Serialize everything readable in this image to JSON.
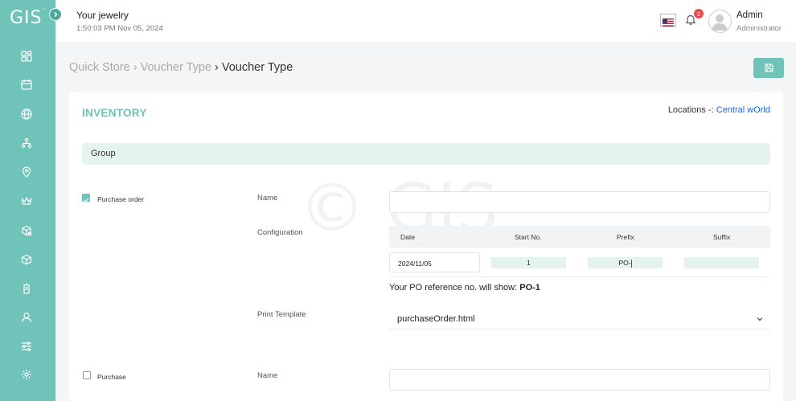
{
  "app": {
    "logo": "GIS",
    "logo_tm": "™"
  },
  "header": {
    "company": "Your jewelry",
    "datetime": "1:50:03 PM Nov 05, 2024",
    "notification_count": "2",
    "user_name": "Admin",
    "user_role": "Administrator"
  },
  "sidebar": {
    "items": [
      {
        "icon": "dashboard-icon"
      },
      {
        "icon": "calendar-icon"
      },
      {
        "icon": "globe-icon"
      },
      {
        "icon": "hierarchy-icon"
      },
      {
        "icon": "location-pin-icon"
      },
      {
        "icon": "crown-icon"
      },
      {
        "icon": "package-search-icon"
      },
      {
        "icon": "box-icon"
      },
      {
        "icon": "mobile-icon"
      },
      {
        "icon": "user-icon"
      },
      {
        "icon": "sliders-icon"
      },
      {
        "icon": "settings-icon"
      }
    ]
  },
  "breadcrumb": {
    "items": [
      "Quick Store",
      "Voucher Type"
    ],
    "current": "Voucher Type"
  },
  "page": {
    "section_title": "INVENTORY",
    "locations_label": "Locations -:",
    "locations_value": "Central wOrld",
    "group_title": "Group",
    "watermark": "© GIS"
  },
  "purchase_order": {
    "checkbox_label": "Purchase order",
    "checked": true,
    "name_label": "Name",
    "name_value": "",
    "configuration_label": "Configuration",
    "config_headers": [
      "Date",
      "Start No.",
      "Prefix",
      "Suffix"
    ],
    "config_values": {
      "date": "2024/11/05",
      "start_no": "1",
      "prefix": "PO-",
      "suffix": ""
    },
    "ref_note_label": "Your PO reference no. will show:",
    "ref_note_value": "PO-1",
    "print_template_label": "Print Template",
    "print_template_value": "purchaseOrder.html"
  },
  "purchase": {
    "checkbox_label": "Purchase",
    "checked": false,
    "name_label": "Name",
    "name_value": ""
  },
  "colors": {
    "accent": "#6fc3b8",
    "link": "#1a63d6",
    "badge": "#e84c4c",
    "group_bg": "#e4f2f0"
  }
}
